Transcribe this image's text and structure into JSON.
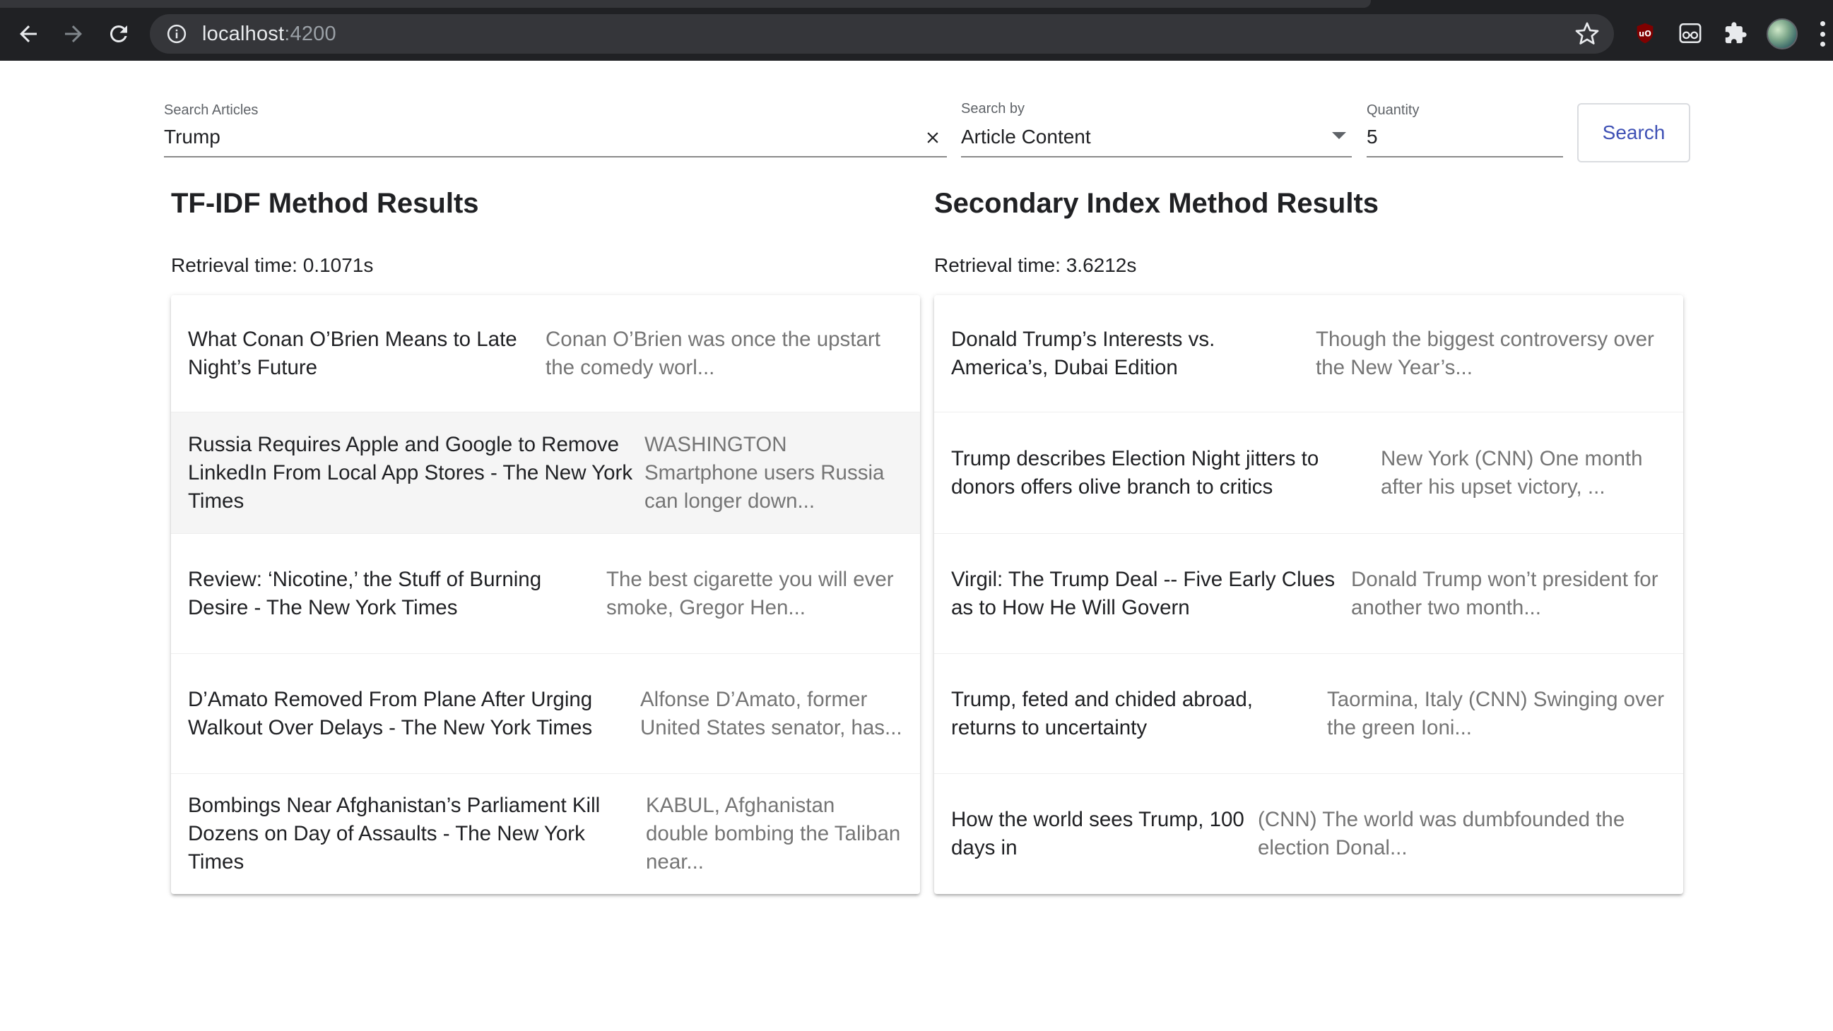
{
  "browser": {
    "url_host": "localhost",
    "url_port": ":4200"
  },
  "search": {
    "query_label": "Search Articles",
    "query_value": "Trump",
    "search_by_label": "Search by",
    "search_by_value": "Article Content",
    "quantity_label": "Quantity",
    "quantity_value": "5",
    "button_label": "Search"
  },
  "tfidf": {
    "title": "TF-IDF Method Results",
    "retrieval": "Retrieval time: 0.1071s",
    "results": [
      {
        "title": "What Conan O’Brien Means to Late Night’s Future",
        "snippet": "Conan O’Brien was once the upstart the comedy worl..."
      },
      {
        "title": "Russia Requires Apple and Google to Remove LinkedIn From Local App Stores - The New York Times",
        "snippet": "WASHINGTON Smartphone users Russia can longer down..."
      },
      {
        "title": "Review: ‘Nicotine,’ the Stuff of Burning Desire - The New York Times",
        "snippet": "The best cigarette you will ever smoke, Gregor Hen..."
      },
      {
        "title": "D’Amato Removed From Plane After Urging Walkout Over Delays - The New York Times",
        "snippet": "Alfonse D’Amato, former United States senator, has..."
      },
      {
        "title": "Bombings Near Afghanistan’s Parliament Kill Dozens on Day of Assaults - The New York Times",
        "snippet": "KABUL, Afghanistan double bombing the Taliban near..."
      }
    ]
  },
  "secondary": {
    "title": "Secondary Index Method Results",
    "retrieval": "Retrieval time: 3.6212s",
    "results": [
      {
        "title": "Donald Trump’s Interests vs. America’s, Dubai Edition",
        "snippet": "Though the biggest controversy over the New Year’s..."
      },
      {
        "title": "Trump describes Election Night jitters to donors offers olive branch to critics",
        "snippet": "New York (CNN) One month after his upset victory, ..."
      },
      {
        "title": "Virgil: The Trump Deal -- Five Early Clues as to How He Will Govern",
        "snippet": "Donald Trump won’t president for another two month..."
      },
      {
        "title": "Trump, feted and chided abroad, returns to uncertainty",
        "snippet": "Taormina, Italy (CNN) Swinging over the green Ioni..."
      },
      {
        "title": "How the world sees Trump, 100 days in",
        "snippet": "(CNN) The world was dumbfounded the election Donal..."
      }
    ]
  }
}
